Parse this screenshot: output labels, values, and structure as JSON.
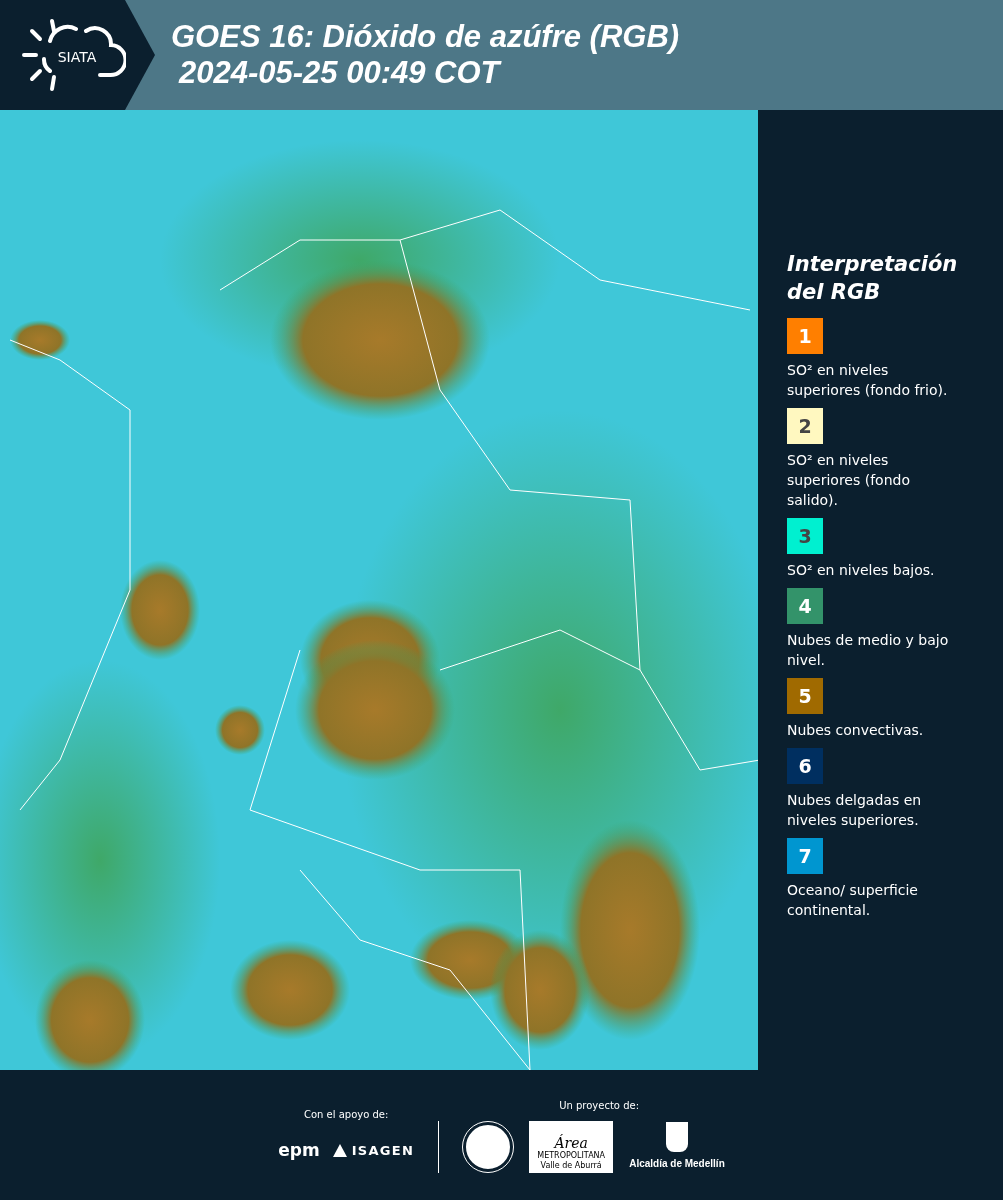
{
  "header": {
    "logo_text": "SIATA",
    "title_line_1": "GOES 16: Dióxido de azúfre (RGB)",
    "title_line_2": "2024-05-25 00:49 COT"
  },
  "legend": {
    "title": "Interpretación del RGB",
    "items": [
      {
        "number": "1",
        "color": "#ff7f00",
        "text": "SO² en niveles superiores (fondo frio)."
      },
      {
        "number": "2",
        "color": "#fff8c0",
        "text": "SO² en niveles superiores (fondo salido)."
      },
      {
        "number": "3",
        "color": "#00f0d0",
        "text": "SO² en niveles bajos."
      },
      {
        "number": "4",
        "color": "#33936a",
        "text": "Nubes de medio y bajo nivel."
      },
      {
        "number": "5",
        "color": "#a06a00",
        "text": "Nubes convectivas."
      },
      {
        "number": "6",
        "color": "#002f60",
        "text": "Nubes delgadas en niveles superiores."
      },
      {
        "number": "7",
        "color": "#0096d0",
        "text": "Oceano/ superficie continental."
      }
    ]
  },
  "footer": {
    "support_label": "Con el apoyo de:",
    "support_logos": [
      "epm",
      "ISAGEN"
    ],
    "project_label": "Un proyecto de:",
    "area_logo": {
      "title": "Área",
      "line_1": "METROPOLITANA",
      "line_2": "Valle de Aburrá"
    },
    "alcaldia_label": "Alcaldía de Medellín"
  }
}
